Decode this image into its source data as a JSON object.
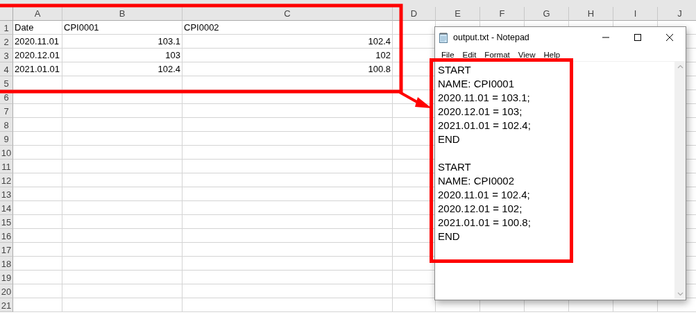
{
  "sheet": {
    "columns": [
      "A",
      "B",
      "C",
      "D",
      "E",
      "F",
      "G",
      "H",
      "I",
      "J"
    ],
    "rows": [
      {
        "number": "1",
        "cells": [
          {
            "text": "Date",
            "kind": "text"
          },
          {
            "text": "CPI0001",
            "kind": "text"
          },
          {
            "text": "CPI0002",
            "kind": "text"
          }
        ]
      },
      {
        "number": "2",
        "cells": [
          {
            "text": "2020.11.01",
            "kind": "text"
          },
          {
            "text": "103.1",
            "kind": "number"
          },
          {
            "text": "102.4",
            "kind": "number"
          }
        ]
      },
      {
        "number": "3",
        "cells": [
          {
            "text": "2020.12.01",
            "kind": "text"
          },
          {
            "text": "103",
            "kind": "number"
          },
          {
            "text": "102",
            "kind": "number"
          }
        ]
      },
      {
        "number": "4",
        "cells": [
          {
            "text": "2021.01.01",
            "kind": "text"
          },
          {
            "text": "102.4",
            "kind": "number"
          },
          {
            "text": "100.8",
            "kind": "number"
          }
        ]
      },
      {
        "number": "5"
      },
      {
        "number": "6"
      },
      {
        "number": "7"
      },
      {
        "number": "8"
      },
      {
        "number": "9"
      },
      {
        "number": "10"
      },
      {
        "number": "11"
      },
      {
        "number": "12"
      },
      {
        "number": "13"
      },
      {
        "number": "14"
      },
      {
        "number": "15"
      },
      {
        "number": "16"
      },
      {
        "number": "17"
      },
      {
        "number": "18"
      },
      {
        "number": "19"
      },
      {
        "number": "20"
      },
      {
        "number": "21"
      }
    ]
  },
  "notepad": {
    "title": "output.txt - Notepad",
    "menu": [
      "File",
      "Edit",
      "Format",
      "View",
      "Help"
    ],
    "blocks": [
      [
        "START",
        "NAME: CPI0001",
        "2020.11.01 = 103.1;",
        "2020.12.01 = 103;",
        "2021.01.01 = 102.4;",
        "END"
      ],
      [
        "START",
        "NAME: CPI0002",
        "2020.11.01 = 102.4;",
        "2020.12.01 = 102;",
        "2021.01.01 = 100.8;",
        "END"
      ]
    ]
  }
}
